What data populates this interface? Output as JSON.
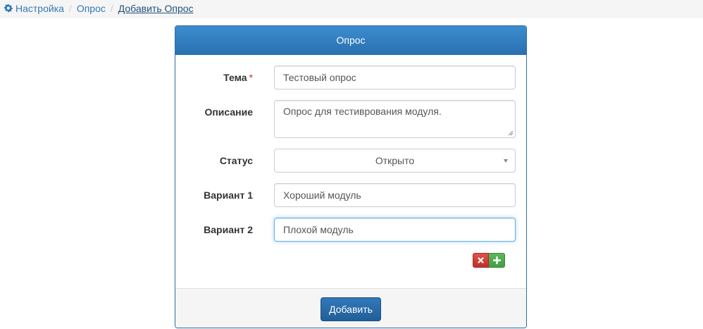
{
  "breadcrumb": {
    "items": [
      "Настройка",
      "Опрос"
    ],
    "separator": "/",
    "active": "Добавить Опрос",
    "icon": "gear-icon"
  },
  "panel": {
    "title": "Опрос"
  },
  "form": {
    "topic": {
      "label": "Тема",
      "required_mark": "*",
      "value": "Тестовый опрос"
    },
    "description": {
      "label": "Описание",
      "value": "Опрос для тестиврования модуля."
    },
    "status": {
      "label": "Статус",
      "value": "Открыто"
    },
    "option1": {
      "label": "Вариант 1",
      "value": "Хороший модуль"
    },
    "option2": {
      "label": "Вариант 2",
      "value": "Плохой модуль"
    },
    "controls": {
      "remove_icon": "remove-option-icon",
      "add_icon": "add-option-icon"
    }
  },
  "footer": {
    "submit_label": "Добавить"
  },
  "colors": {
    "primary": "#337ab7",
    "panel_header": "#3178b8",
    "danger": "#d9534f",
    "success": "#5cb85c",
    "required": "#c9302c"
  }
}
